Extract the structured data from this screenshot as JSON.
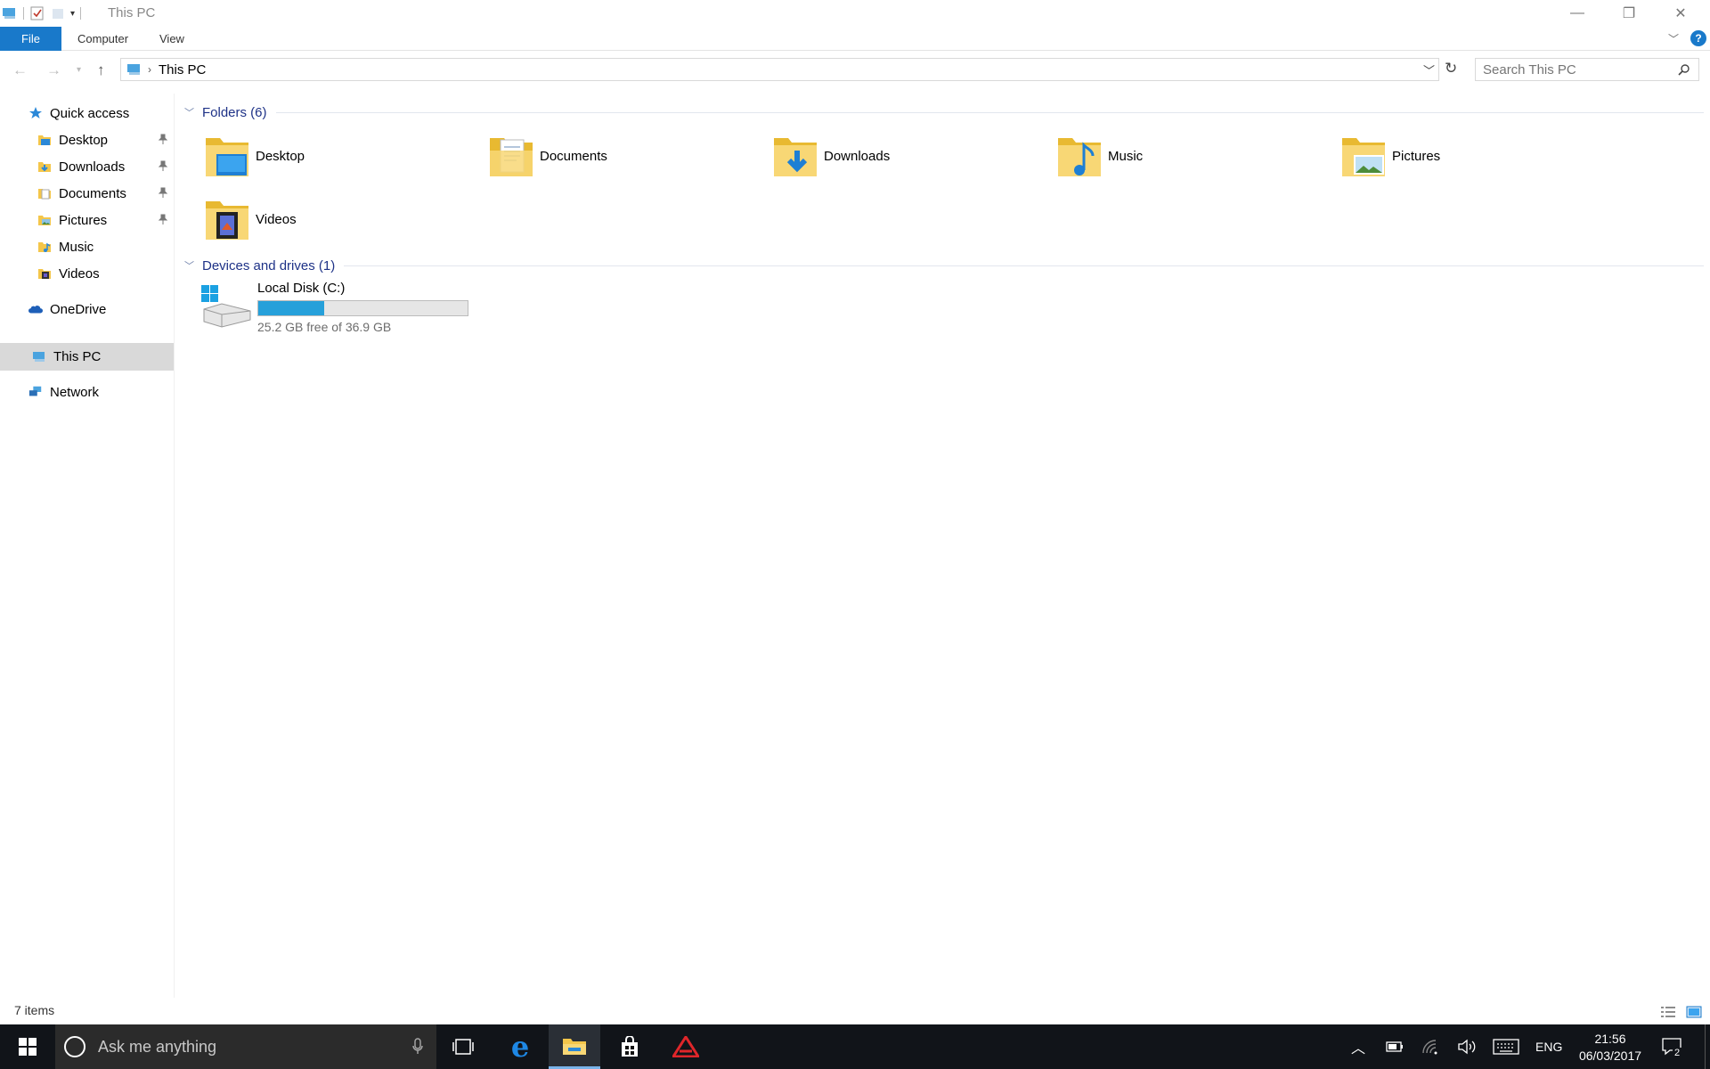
{
  "window": {
    "title": "This PC"
  },
  "ribbon": {
    "tabs": [
      "File",
      "Computer",
      "View"
    ]
  },
  "address": {
    "path": "This PC",
    "search_placeholder": "Search This PC"
  },
  "nav_pane": {
    "quick_access": "Quick access",
    "quick_items": [
      {
        "label": "Desktop",
        "pinned": true,
        "icon": "desktop-folder-icon"
      },
      {
        "label": "Downloads",
        "pinned": true,
        "icon": "downloads-folder-icon"
      },
      {
        "label": "Documents",
        "pinned": true,
        "icon": "documents-folder-icon"
      },
      {
        "label": "Pictures",
        "pinned": true,
        "icon": "pictures-folder-icon"
      },
      {
        "label": "Music",
        "pinned": false,
        "icon": "music-folder-icon"
      },
      {
        "label": "Videos",
        "pinned": false,
        "icon": "videos-folder-icon"
      }
    ],
    "onedrive": "OneDrive",
    "this_pc": "This PC",
    "network": "Network"
  },
  "content": {
    "folders_header": "Folders (6)",
    "folders": [
      "Desktop",
      "Documents",
      "Downloads",
      "Music",
      "Pictures",
      "Videos"
    ],
    "devices_header": "Devices and drives (1)",
    "drive": {
      "name": "Local Disk (C:)",
      "free_text": "25.2 GB free of 36.9 GB",
      "used_fraction": 0.317
    }
  },
  "status": {
    "count": "7 items"
  },
  "taskbar": {
    "search_placeholder": "Ask me anything",
    "language": "ENG",
    "time": "21:56",
    "date": "06/03/2017",
    "notifications": "2"
  },
  "colors": {
    "accent": "#1979ca",
    "drive_fill": "#26a0da",
    "group_header": "#1e3287",
    "taskbar": "#111419"
  }
}
